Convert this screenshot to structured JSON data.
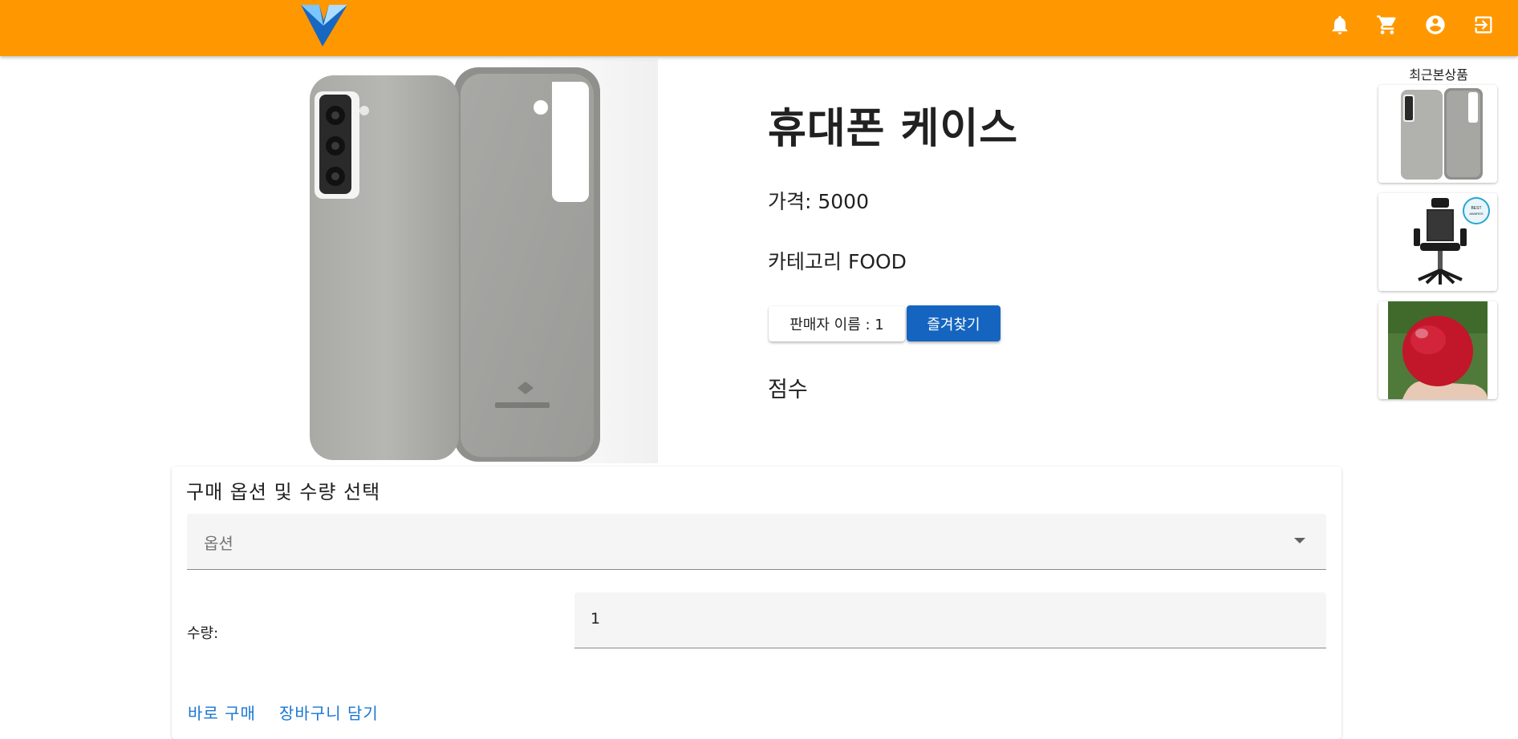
{
  "header": {
    "logo": "vuetify-logo",
    "background": "#ff9800",
    "icons": [
      "bell-icon",
      "cart-icon",
      "account-icon",
      "logout-icon"
    ]
  },
  "product": {
    "image": "phone-case-image",
    "title": "휴대폰 케이스",
    "price": "가격: 5000",
    "category": "카테고리 FOOD",
    "seller_label": "판매자 이름 : 1",
    "favorite_label": "즐겨찾기",
    "score_label": "점수"
  },
  "recent": {
    "title": "최근본상품",
    "items": [
      "phone-case-thumbnail",
      "office-chair-thumbnail",
      "apple-thumbnail"
    ]
  },
  "purchase": {
    "title": "구매 옵션 및 수량 선택",
    "option_placeholder": "옵션",
    "quantity_label": "수량:",
    "quantity_value": "1",
    "buy_now": "바로 구매",
    "add_to_cart": "장바구니 담기"
  },
  "colors": {
    "accent": "#ff9800",
    "primary_button": "#1565c0",
    "link": "#1976d2"
  }
}
